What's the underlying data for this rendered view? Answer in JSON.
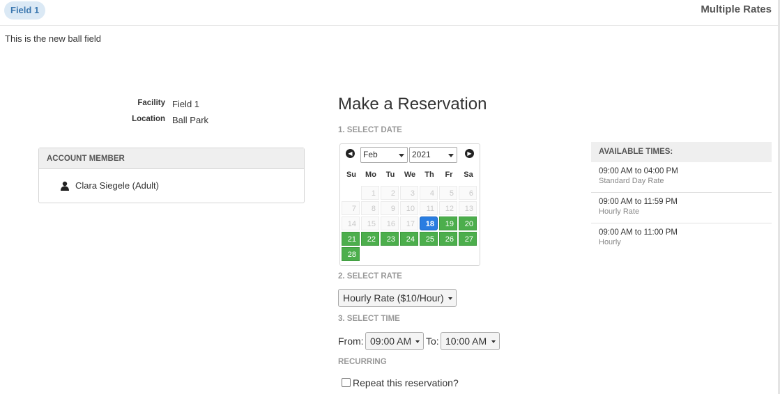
{
  "header": {
    "field_pill": "Field 1",
    "rates_title": "Multiple Rates"
  },
  "description": "This is the new ball field",
  "facility": {
    "facility_label": "Facility",
    "facility_value": "Field 1",
    "location_label": "Location",
    "location_value": "Ball Park"
  },
  "account": {
    "heading": "ACCOUNT MEMBER",
    "member": "Clara Siegele (Adult)",
    "member_icon": "person-icon"
  },
  "reservation": {
    "title": "Make a Reservation",
    "step1": "1. SELECT DATE",
    "step2": "2. SELECT RATE",
    "step3": "3. SELECT TIME",
    "recurring": "RECURRING",
    "repeat_label": "Repeat this reservation?",
    "rate_selected": "Hourly Rate ($10/Hour)",
    "from_label": "From:",
    "from_value": "09:00 AM",
    "to_label": "To:",
    "to_value": "10:00 AM"
  },
  "calendar": {
    "month": "Feb",
    "year": "2021",
    "prev_icon": "chevron-left-icon",
    "next_icon": "chevron-right-icon",
    "weekdays": [
      "Su",
      "Mo",
      "Tu",
      "We",
      "Th",
      "Fr",
      "Sa"
    ],
    "days": [
      [
        "",
        "1",
        "2",
        "3",
        "4",
        "5",
        "6"
      ],
      [
        "7",
        "8",
        "9",
        "10",
        "11",
        "12",
        "13"
      ],
      [
        "14",
        "15",
        "16",
        "17",
        "18",
        "19",
        "20"
      ],
      [
        "21",
        "22",
        "23",
        "24",
        "25",
        "26",
        "27"
      ],
      [
        "28",
        "",
        "",
        "",
        "",
        "",
        ""
      ]
    ],
    "states": [
      [
        "blank",
        "disabled",
        "disabled",
        "disabled",
        "disabled",
        "disabled",
        "disabled"
      ],
      [
        "disabled",
        "disabled",
        "disabled",
        "disabled",
        "disabled",
        "disabled",
        "disabled"
      ],
      [
        "disabled",
        "disabled",
        "disabled",
        "disabled",
        "today",
        "avail",
        "avail"
      ],
      [
        "avail",
        "avail",
        "avail",
        "avail",
        "avail",
        "avail",
        "avail"
      ],
      [
        "avail",
        "blank",
        "blank",
        "blank",
        "blank",
        "blank",
        "blank"
      ]
    ],
    "colors": {
      "available": "#4cae4c",
      "selected": "#2a7de1"
    }
  },
  "available_times": {
    "heading": "AVAILABLE TIMES:",
    "items": [
      {
        "time": "09:00 AM to 04:00 PM",
        "rate": "Standard Day Rate"
      },
      {
        "time": "09:00 AM to 11:59 PM",
        "rate": "Hourly Rate"
      },
      {
        "time": "09:00 AM to 11:00 PM",
        "rate": "Hourly"
      }
    ]
  }
}
